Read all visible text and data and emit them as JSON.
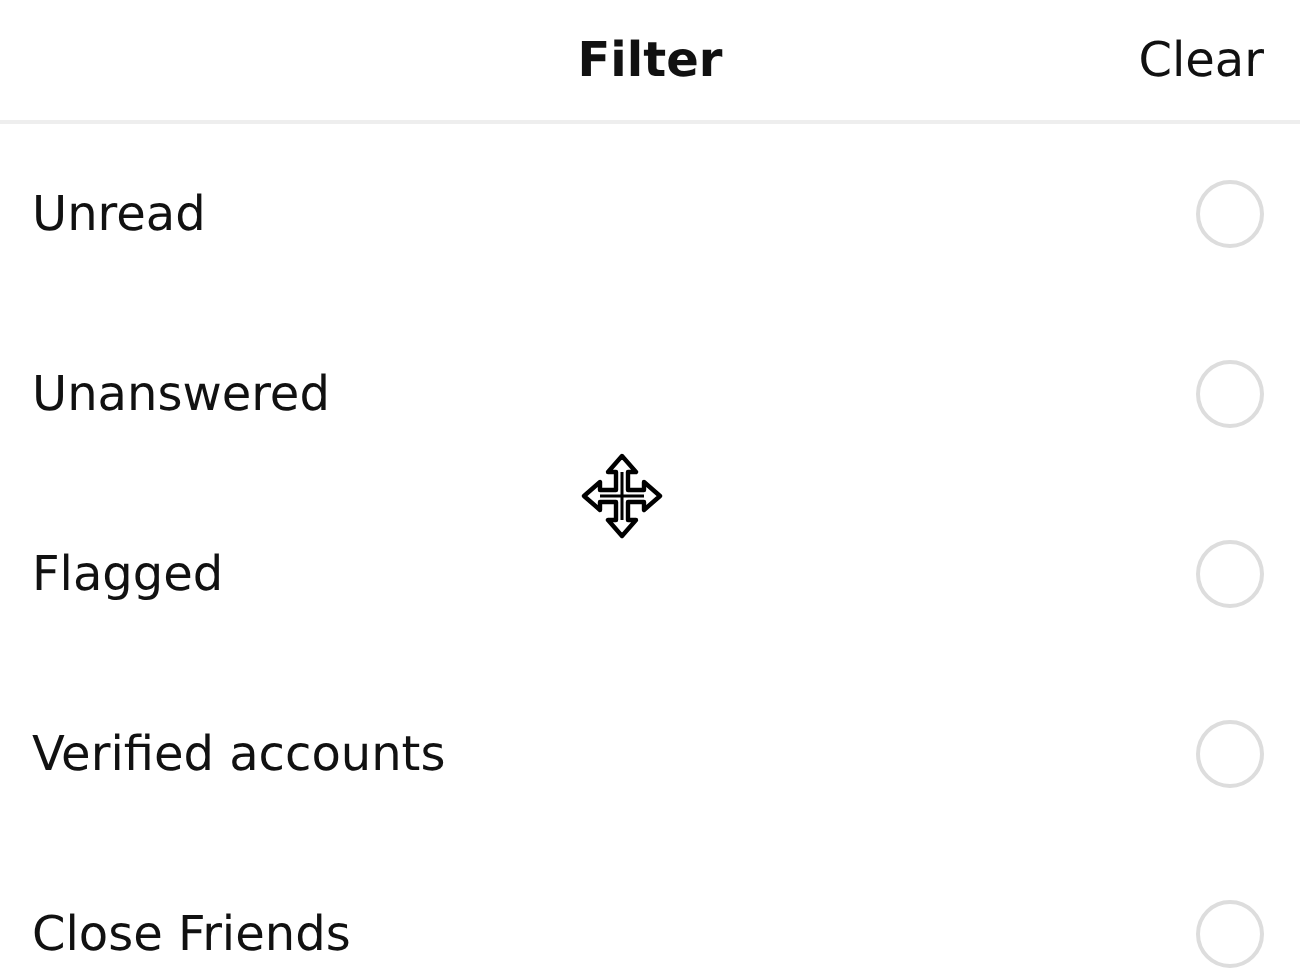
{
  "header": {
    "title": "Filter",
    "clear_label": "Clear"
  },
  "options": [
    {
      "label": "Unread",
      "selected": false
    },
    {
      "label": "Unanswered",
      "selected": false
    },
    {
      "label": "Flagged",
      "selected": false
    },
    {
      "label": "Verified accounts",
      "selected": false
    },
    {
      "label": "Close Friends",
      "selected": false
    }
  ]
}
